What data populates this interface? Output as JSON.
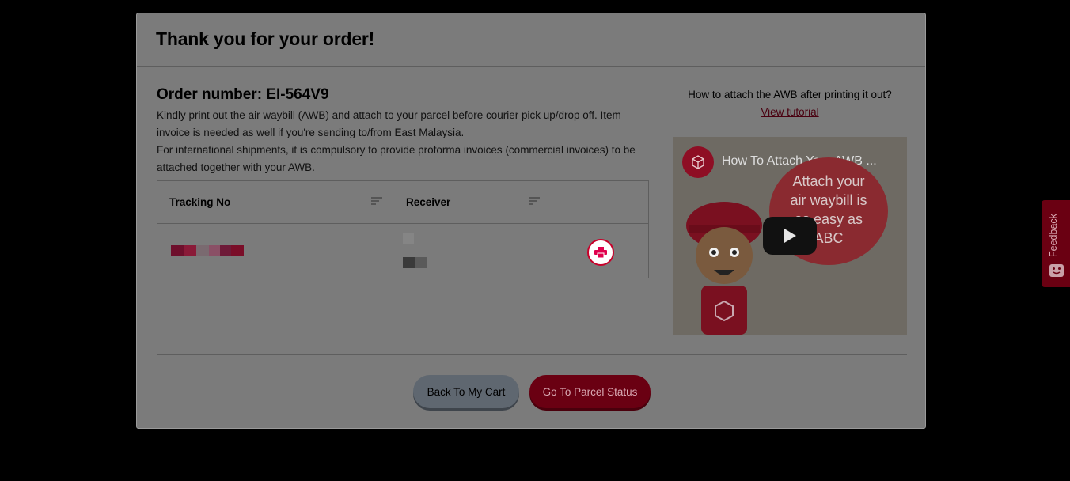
{
  "modal": {
    "title": "Thank you for your order!"
  },
  "order": {
    "number_label": "Order number: EI-564V9",
    "paragraphs": [
      "Kindly print out the air waybill (AWB) and attach to your parcel before courier pick up/drop off. Item invoice is needed as well if you're sending to/from East Malaysia.",
      "For international shipments, it is compulsory to provide proforma invoices (commercial invoices) to be attached together with your AWB."
    ]
  },
  "table": {
    "columns": [
      "Tracking No",
      "Receiver"
    ],
    "row_note": "tracking number and receiver details are pixelated in the screenshot"
  },
  "tutorial": {
    "question": "How to attach the AWB after printing it out?",
    "link_label": "View tutorial",
    "video_title": "How To Attach Your AWB ...",
    "video_bubble_text": "Attach your air waybill is as easy as ABC"
  },
  "buttons": {
    "back": "Back To My Cart",
    "go": "Go To Parcel Status"
  },
  "feedback": {
    "label": "Feedback"
  },
  "colors": {
    "accent": "#c8002a",
    "backdrop": "#000000",
    "modal_dimmed": "#7b7b7b"
  }
}
